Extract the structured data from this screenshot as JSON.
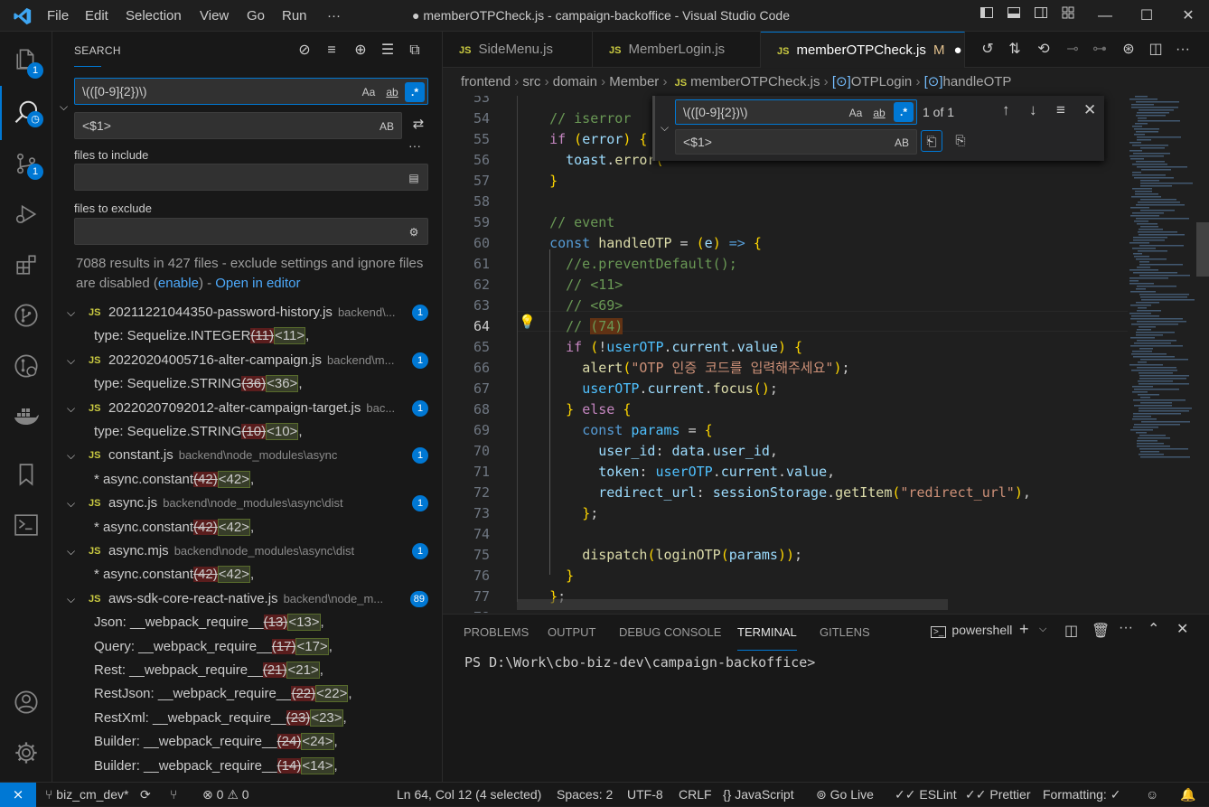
{
  "titlebar": {
    "menus": [
      "File",
      "Edit",
      "Selection",
      "View",
      "Go",
      "Run",
      "···"
    ],
    "title": "● memberOTPCheck.js - campaign-backoffice - Visual Studio Code",
    "layout_icons": [
      "layout-sidebar-left-icon",
      "layout-panel-icon",
      "layout-sidebar-right-icon",
      "customize-layout-icon"
    ],
    "window": {
      "minimize": "—",
      "maximize": "☐",
      "close": "✕"
    }
  },
  "activity": {
    "items": [
      {
        "icon": "explorer-icon",
        "badge": "1"
      },
      {
        "icon": "search-icon",
        "badge": ""
      },
      {
        "icon": "source-control-icon",
        "badge": "1"
      },
      {
        "icon": "run-debug-icon",
        "badge": ""
      },
      {
        "icon": "extensions-icon",
        "badge": ""
      },
      {
        "icon": "git-graph-icon",
        "badge": ""
      },
      {
        "icon": "remote-icon",
        "badge": ""
      },
      {
        "icon": "docker-icon",
        "badge": ""
      },
      {
        "icon": "bookmark-icon",
        "badge": ""
      },
      {
        "icon": "terminal-icon",
        "badge": ""
      }
    ],
    "account_icon": "account-icon",
    "settings_icon": "settings-gear-icon"
  },
  "search": {
    "title": "SEARCH",
    "query": "\\(([0-9]{2})\\)",
    "replace": "<$1>",
    "match_case": "Aa",
    "whole_word": "ab",
    "regex": ".*",
    "preserve_case": "AB",
    "more": "···",
    "include_label": "files to include",
    "exclude_label": "files to exclude",
    "summary": "7088 results in 427 files - exclude settings and ignore files are disabled (",
    "summary_link": "enable",
    "summary_close": ") - ",
    "open_editor": "Open in editor",
    "results": [
      {
        "type": "file",
        "name": "20211221044350-password-history.js",
        "path": "backend\\...",
        "count": "1"
      },
      {
        "type": "match",
        "pre": "type: Sequelize.INTEGER",
        "del": "(11)",
        "ins": "<11>",
        "post": ","
      },
      {
        "type": "file",
        "name": "20220204005716-alter-campaign.js",
        "path": "backend\\m...",
        "count": "1"
      },
      {
        "type": "match",
        "pre": "type: Sequelize.STRING",
        "del": "(36)",
        "ins": "<36>",
        "post": ","
      },
      {
        "type": "file",
        "name": "20220207092012-alter-campaign-target.js",
        "path": "bac...",
        "count": "1"
      },
      {
        "type": "match",
        "pre": "type: Sequelize.STRING",
        "del": "(10)",
        "ins": "<10>",
        "post": ","
      },
      {
        "type": "file",
        "name": "constant.js",
        "path": "backend\\node_modules\\async",
        "count": "1"
      },
      {
        "type": "match",
        "pre": "*     async.constant",
        "del": "(42)",
        "ins": "<42>",
        "post": ","
      },
      {
        "type": "file",
        "name": "async.js",
        "path": "backend\\node_modules\\async\\dist",
        "count": "1"
      },
      {
        "type": "match",
        "pre": "*     async.constant",
        "del": "(42)",
        "ins": "<42>",
        "post": ","
      },
      {
        "type": "file",
        "name": "async.mjs",
        "path": "backend\\node_modules\\async\\dist",
        "count": "1"
      },
      {
        "type": "match",
        "pre": "*     async.constant",
        "del": "(42)",
        "ins": "<42>",
        "post": ","
      },
      {
        "type": "file",
        "name": "aws-sdk-core-react-native.js",
        "path": "backend\\node_m...",
        "count": "89"
      },
      {
        "type": "match",
        "pre": "Json: __webpack_require__",
        "del": "(13)",
        "ins": "<13>",
        "post": ","
      },
      {
        "type": "match",
        "pre": "Query: __webpack_require__",
        "del": "(17)",
        "ins": "<17>",
        "post": ","
      },
      {
        "type": "match",
        "pre": "Rest: __webpack_require__",
        "del": "(21)",
        "ins": "<21>",
        "post": ","
      },
      {
        "type": "match",
        "pre": "RestJson: __webpack_require__",
        "del": "(22)",
        "ins": "<22>",
        "post": ","
      },
      {
        "type": "match",
        "pre": "RestXml: __webpack_require__",
        "del": "(23)",
        "ins": "<23>",
        "post": ","
      },
      {
        "type": "match",
        "pre": "Builder: __webpack_require__",
        "del": "(24)",
        "ins": "<24>",
        "post": ","
      },
      {
        "type": "match",
        "pre": "Builder: __webpack_require__",
        "del": "(14)",
        "ins": "<14>",
        "post": ","
      }
    ]
  },
  "tabs": [
    {
      "label": "SideMenu.js",
      "active": false,
      "modified": ""
    },
    {
      "label": "MemberLogin.js",
      "active": false,
      "modified": ""
    },
    {
      "label": "memberOTPCheck.js",
      "active": true,
      "modified": "M"
    }
  ],
  "breadcrumbs": [
    "frontend",
    "src",
    "domain",
    "Member",
    "memberOTPCheck.js",
    "OTPLogin",
    "handleOTP"
  ],
  "find": {
    "query": "\\(([0-9]{2})\\)",
    "replace": "<$1>",
    "count": "1 of 1",
    "aa": "Aa",
    "ab": "ab",
    "re": ".*",
    "AB": "AB"
  },
  "editor": {
    "current_line": "64",
    "lines": [
      {
        "n": "53",
        "t": ""
      },
      {
        "n": "54",
        "t": "  <span class=c>// iserror</span>"
      },
      {
        "n": "55",
        "t": "  <span class=kc>if</span> <span class=p>(</span><span class=v>error</span><span class=p>)</span> <span class=p>{</span>"
      },
      {
        "n": "56",
        "t": "    <span class=v>toast</span>.<span class=f>error</span><span class=p>(</span>"
      },
      {
        "n": "57",
        "t": "  <span class=p>}</span>"
      },
      {
        "n": "58",
        "t": ""
      },
      {
        "n": "59",
        "t": "  <span class=c>// event</span>"
      },
      {
        "n": "60",
        "t": "  <span class=k>const</span> <span class=f>handleOTP</span> = <span class=p>(</span><span class=v>e</span><span class=p>)</span> <span class=k>=&gt;</span> <span class=p>{</span>"
      },
      {
        "n": "61",
        "t": "    <span class=c>//e.preventDefault();</span>"
      },
      {
        "n": "62",
        "t": "    <span class=c>// &lt;11&gt;</span>"
      },
      {
        "n": "63",
        "t": "    <span class=c>// &lt;69&gt;</span>"
      },
      {
        "n": "64",
        "t": "    <span class=c>// <span style=\"background:#613214\">(74)</span></span>"
      },
      {
        "n": "65",
        "t": "    <span class=kc>if</span> <span class=p>(</span>!<span class=cn>userOTP</span>.<span class=v>current</span>.<span class=v>value</span><span class=p>)</span> <span class=p>{</span>"
      },
      {
        "n": "66",
        "t": "      <span class=f>alert</span><span class=p>(</span><span class=s>\"OTP 인증 코드를 입력해주세요\"</span><span class=p>)</span>;"
      },
      {
        "n": "67",
        "t": "      <span class=cn>userOTP</span>.<span class=v>current</span>.<span class=f>focus</span><span class=p>()</span>;"
      },
      {
        "n": "68",
        "t": "    <span class=p>}</span> <span class=kc>else</span> <span class=p>{</span>"
      },
      {
        "n": "69",
        "t": "      <span class=k>const</span> <span class=cn>params</span> = <span class=p>{</span>"
      },
      {
        "n": "70",
        "t": "        <span class=v>user_id</span>: <span class=v>data</span>.<span class=v>user_id</span>,"
      },
      {
        "n": "71",
        "t": "        <span class=v>token</span>: <span class=cn>userOTP</span>.<span class=v>current</span>.<span class=v>value</span>,"
      },
      {
        "n": "72",
        "t": "        <span class=v>redirect_url</span>: <span class=v>sessionStorage</span>.<span class=f>getItem</span><span class=p>(</span><span class=s>\"redirect_url\"</span><span class=p>)</span>,"
      },
      {
        "n": "73",
        "t": "      <span class=p>}</span>;"
      },
      {
        "n": "74",
        "t": ""
      },
      {
        "n": "75",
        "t": "      <span class=f>dispatch</span><span class=p>(</span><span class=f>loginOTP</span><span class=p>(</span><span class=v>params</span><span class=p>))</span>;"
      },
      {
        "n": "76",
        "t": "    <span class=p>}</span>"
      },
      {
        "n": "77",
        "t": "  <span class=p>}</span>;"
      },
      {
        "n": "78",
        "t": ""
      }
    ]
  },
  "panel": {
    "tabs": [
      "PROBLEMS",
      "OUTPUT",
      "DEBUG CONSOLE",
      "TERMINAL",
      "GITLENS"
    ],
    "active": "TERMINAL",
    "shell": "powershell",
    "prompt": "PS D:\\Work\\cbo-biz-dev\\campaign-backoffice>"
  },
  "status": {
    "branch": "biz_cm_dev*",
    "errors": "0",
    "warnings": "0",
    "position": "Ln 64, Col 12 (4 selected)",
    "spaces": "Spaces: 2",
    "encoding": "UTF-8",
    "eol": "CRLF",
    "language": "JavaScript",
    "golive": "Go Live",
    "eslint": "ESLint",
    "prettier": "Prettier",
    "formatting": "Formatting: ✓"
  },
  "colors": {
    "accent": "#0078d4",
    "badge": "#0078d4",
    "js": "#cbcb41"
  }
}
